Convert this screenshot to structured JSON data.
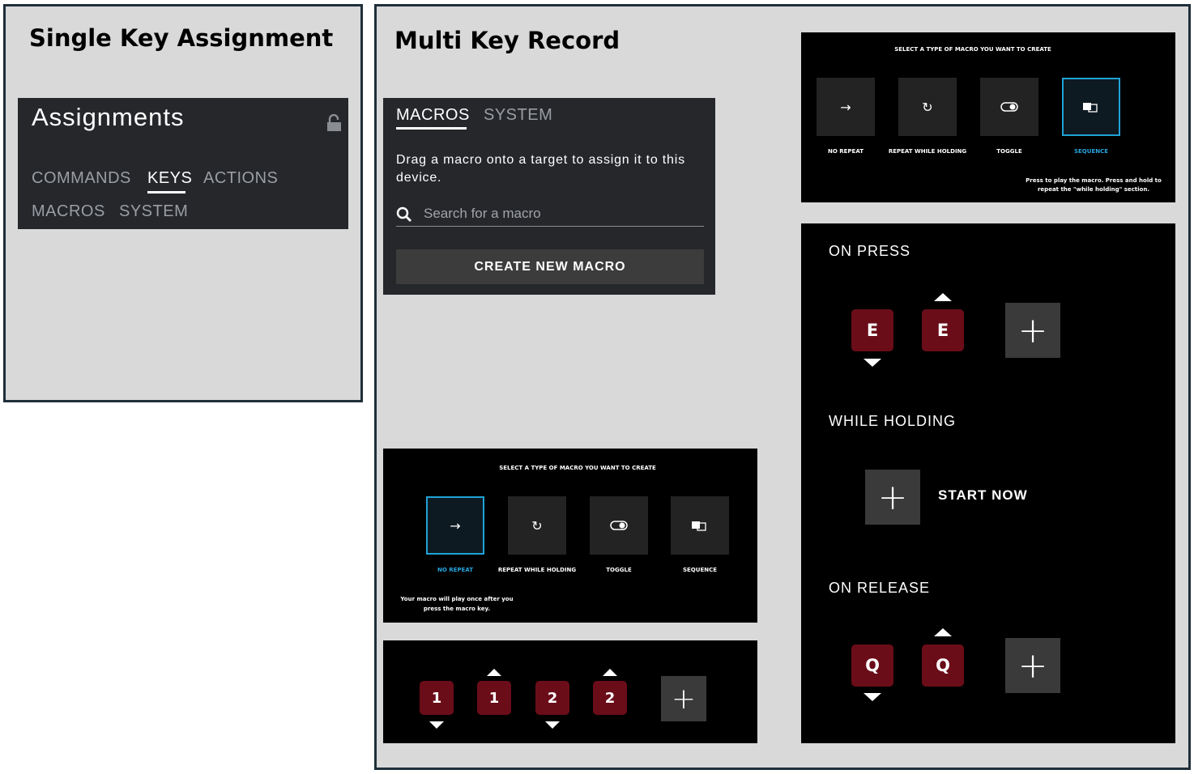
{
  "single": {
    "heading": "Single Key Assignment",
    "panel_title": "Assignments",
    "lock_icon": "unlocked-padlock-icon",
    "tabs": [
      "COMMANDS",
      "KEYS",
      "ACTIONS",
      "MACROS",
      "SYSTEM"
    ],
    "active_tab": "KEYS"
  },
  "multi": {
    "heading": "Multi Key Record",
    "macros_panel": {
      "tabs": [
        "MACROS",
        "SYSTEM"
      ],
      "active_tab": "MACROS",
      "description": "Drag a macro onto a target to assign it to this device.",
      "search_placeholder": "Search for a macro",
      "search_icon": "search-icon",
      "create_button": "CREATE NEW MACRO"
    },
    "macro_type_top": {
      "title": "SELECT A TYPE OF MACRO YOU WANT TO CREATE",
      "options": [
        {
          "label": "NO REPEAT",
          "icon": "arrow-right-icon"
        },
        {
          "label": "REPEAT WHILE HOLDING",
          "icon": "repeat-icon"
        },
        {
          "label": "TOGGLE",
          "icon": "toggle-icon"
        },
        {
          "label": "SEQUENCE",
          "icon": "sequence-icon"
        }
      ],
      "selected": "SEQUENCE",
      "hint": "Press to play the macro. Press and hold to repeat the \"while holding\" section."
    },
    "macro_type_bottom": {
      "title": "SELECT A TYPE OF MACRO YOU WANT TO CREATE",
      "options": [
        {
          "label": "NO REPEAT",
          "icon": "arrow-right-icon"
        },
        {
          "label": "REPEAT WHILE HOLDING",
          "icon": "repeat-icon"
        },
        {
          "label": "TOGGLE",
          "icon": "toggle-icon"
        },
        {
          "label": "SEQUENCE",
          "icon": "sequence-icon"
        }
      ],
      "selected": "NO REPEAT",
      "hint": "Your macro will play once after you press the macro key."
    },
    "key_row": {
      "keys": [
        {
          "label": "1",
          "direction": "down"
        },
        {
          "label": "1",
          "direction": "up"
        },
        {
          "label": "2",
          "direction": "down"
        },
        {
          "label": "2",
          "direction": "up"
        }
      ],
      "add_symbol": "+"
    },
    "sequence": {
      "on_press": {
        "label": "ON PRESS",
        "keys": [
          {
            "label": "E",
            "direction": "down"
          },
          {
            "label": "E",
            "direction": "up"
          }
        ]
      },
      "while_holding": {
        "label": "WHILE HOLDING",
        "start_label": "START NOW"
      },
      "on_release": {
        "label": "ON RELEASE",
        "keys": [
          {
            "label": "Q",
            "direction": "down"
          },
          {
            "label": "Q",
            "direction": "up"
          }
        ]
      },
      "add_symbol": "+"
    }
  },
  "colors": {
    "panel_gray": "#d9d9d9",
    "panel_border": "#1f2f3a",
    "dark_bg": "#25272b",
    "key_red": "#6a0d19",
    "select_blue": "#1fa3d6",
    "plus_gray": "#3a3a3a"
  }
}
